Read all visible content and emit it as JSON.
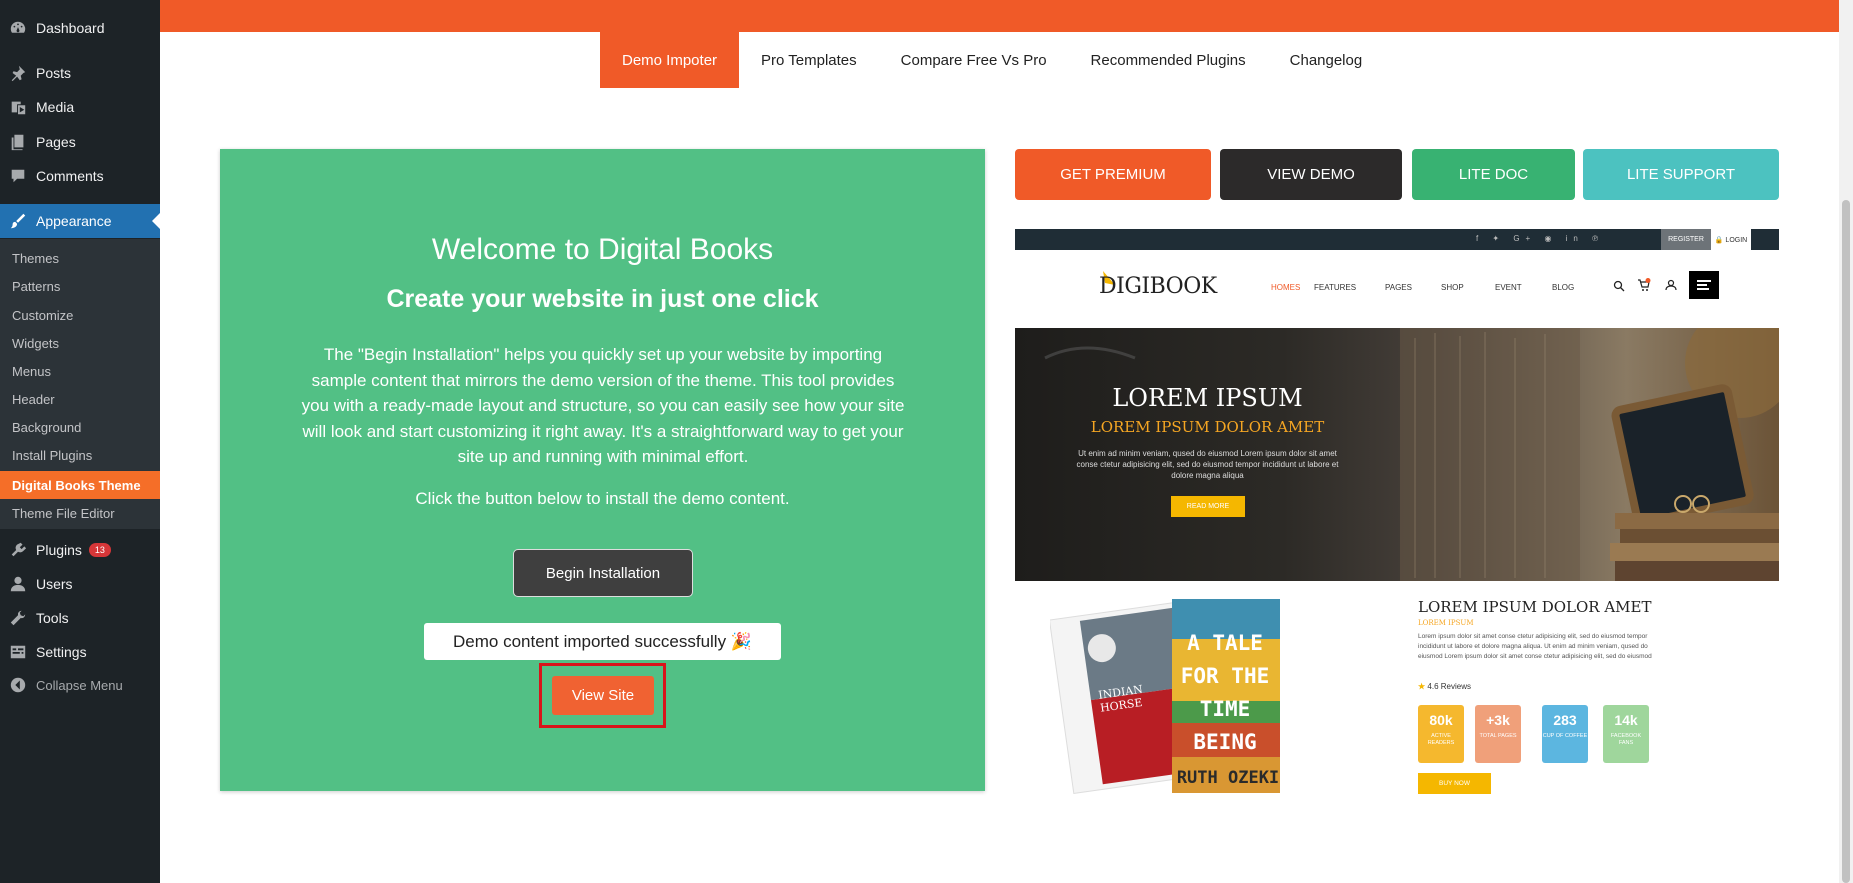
{
  "sidebar": {
    "dashboard": "Dashboard",
    "posts": "Posts",
    "media": "Media",
    "pages": "Pages",
    "comments": "Comments",
    "appearance": "Appearance",
    "sub": {
      "themes": "Themes",
      "patterns": "Patterns",
      "customize": "Customize",
      "widgets": "Widgets",
      "menus": "Menus",
      "header": "Header",
      "background": "Background",
      "install_plugins": "Install Plugins",
      "digital_books_theme": "Digital Books Theme",
      "theme_file_editor": "Theme File Editor"
    },
    "plugins": "Plugins",
    "plugins_badge": "13",
    "users": "Users",
    "tools": "Tools",
    "settings": "Settings",
    "collapse": "Collapse Menu"
  },
  "tabs": {
    "demo_importer": "Demo Impoter",
    "pro_templates": "Pro Templates",
    "compare": "Compare Free Vs Pro",
    "recommended": "Recommended Plugins",
    "changelog": "Changelog"
  },
  "welcome": {
    "title": "Welcome to Digital Books",
    "subtitle": "Create your website in just one click",
    "description": "The \"Begin Installation\" helps you quickly set up your website by importing sample content that mirrors the demo version of the theme. This tool provides you with a ready-made layout and structure, so you can easily see how your site will look and start customizing it right away. It's a straightforward way to get your site up and running with minimal effort.",
    "click_text": "Click the button below to install the demo content.",
    "begin_button": "Begin Installation",
    "success_message": "Demo content imported successfully 🎉",
    "view_site_button": "View Site"
  },
  "actions": {
    "get_premium": "GET PREMIUM",
    "view_demo": "VIEW DEMO",
    "lite_doc": "LITE DOC",
    "lite_support": "LITE SUPPORT"
  },
  "preview": {
    "social": "f  ✦  G+  ◉  in  ℗",
    "register": "REGISTER",
    "login": "🔒 LOGIN",
    "logo": "DIGIBOOK",
    "nav": {
      "homes": "HOMES",
      "features": "FEATURES",
      "pages": "PAGES",
      "shop": "SHOP",
      "event": "EVENT",
      "blog": "BLOG"
    },
    "hero_title": "LOREM IPSUM",
    "hero_subtitle": "LOREM IPSUM DOLOR AMET",
    "hero_text": "Ut enim ad minim veniam, qused do eiusmod  Lorem ipsum dolor sit amet conse ctetur adipisicing elit, sed do eiusmod tempor incididunt ut labore et dolore magna aliqua",
    "read_more": "READ MORE",
    "book1_subtitle": "INDIAN HORSE",
    "book2_title": "A TALE FOR THE TIME BEING",
    "book2_author": "RUTH OZEKI",
    "lower_title": "LOREM IPSUM  DOLOR AMET",
    "lower_sub": "LOREM IPSUM",
    "lower_text": "Lorem ipsum dolor sit amet conse ctetur adipisicing elit, sed do eiusmod tempor incididunt ut labore et dolore magna aliqua. Ut enim ad minim veniam, qused do eiusmod Lorem ipsum dolor sit amet conse ctetur adipisicing elit, sed do eiusmod",
    "rating": "4.6 Reviews",
    "stats": [
      {
        "num": "80k",
        "label": "ACTIVE READERS",
        "color": "#f5b82e"
      },
      {
        "num": "+3k",
        "label": "TOTAL PAGES",
        "color": "#f0a07a"
      },
      {
        "num": "283",
        "label": "CUP OF COFFEE",
        "color": "#5cb6e0"
      },
      {
        "num": "14k",
        "label": "FACEBOOK FANS",
        "color": "#9fd69c"
      }
    ],
    "buy_now": "BUY NOW"
  },
  "colors": {
    "accent": "#f05a28",
    "panel_green": "#52c085",
    "sidebar_bg": "#1d2327",
    "wp_blue": "#2271b1"
  }
}
